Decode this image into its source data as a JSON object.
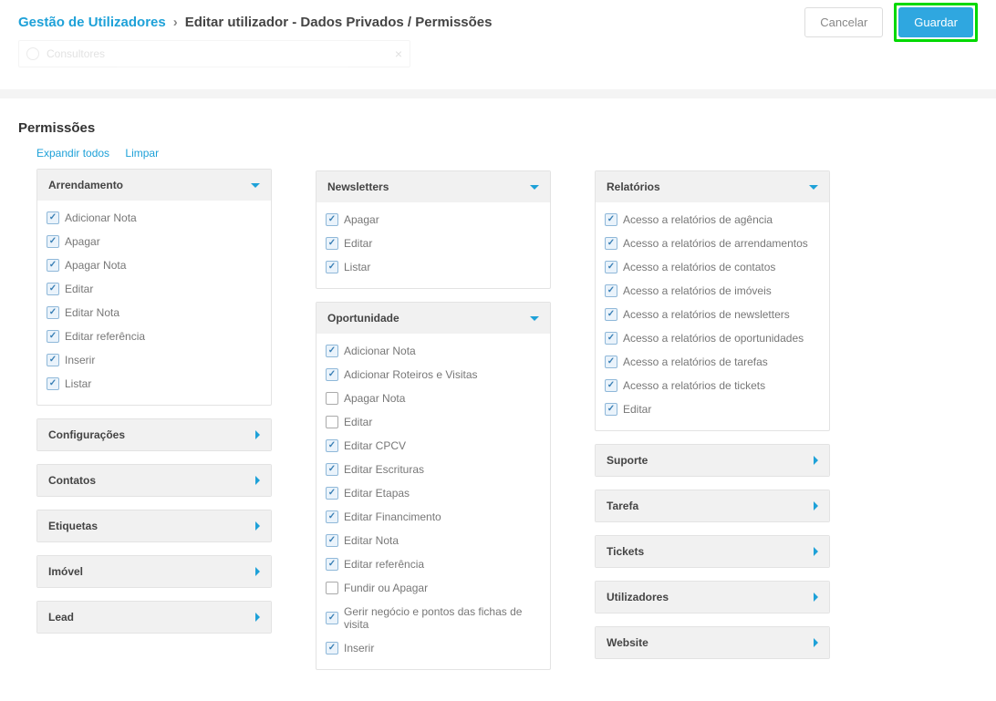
{
  "header": {
    "breadcrumb_link": "Gestão de Utilizadores",
    "separator": "›",
    "current": "Editar utilizador -  Dados Privados / Permissões",
    "cancel_label": "Cancelar",
    "save_label": "Guardar"
  },
  "tag_row": {
    "text": "Consultores",
    "close": "×"
  },
  "section_title": "Permissões",
  "links": {
    "expand_all": "Expandir todos",
    "clear": "Limpar"
  },
  "columns": [
    {
      "panels": [
        {
          "id": "arrendamento",
          "title": "Arrendamento",
          "expanded": true,
          "items": [
            {
              "label": "Adicionar Nota",
              "checked": true
            },
            {
              "label": "Apagar",
              "checked": true
            },
            {
              "label": "Apagar Nota",
              "checked": true
            },
            {
              "label": "Editar",
              "checked": true
            },
            {
              "label": "Editar Nota",
              "checked": true
            },
            {
              "label": "Editar referência",
              "checked": true
            },
            {
              "label": "Inserir",
              "checked": true
            },
            {
              "label": "Listar",
              "checked": true
            }
          ]
        },
        {
          "id": "configuracoes",
          "title": "Configurações",
          "expanded": false
        },
        {
          "id": "contatos",
          "title": "Contatos",
          "expanded": false
        },
        {
          "id": "etiquetas",
          "title": "Etiquetas",
          "expanded": false
        },
        {
          "id": "imovel",
          "title": "Imóvel",
          "expanded": false
        },
        {
          "id": "lead",
          "title": "Lead",
          "expanded": false
        }
      ]
    },
    {
      "panels": [
        {
          "id": "newsletters",
          "title": "Newsletters",
          "expanded": true,
          "items": [
            {
              "label": "Apagar",
              "checked": true
            },
            {
              "label": "Editar",
              "checked": true
            },
            {
              "label": "Listar",
              "checked": true
            }
          ]
        },
        {
          "id": "oportunidade",
          "title": "Oportunidade",
          "expanded": true,
          "items": [
            {
              "label": "Adicionar Nota",
              "checked": true
            },
            {
              "label": "Adicionar Roteiros e Visitas",
              "checked": true
            },
            {
              "label": "Apagar Nota",
              "checked": false
            },
            {
              "label": "Editar",
              "checked": false
            },
            {
              "label": "Editar CPCV",
              "checked": true
            },
            {
              "label": "Editar Escrituras",
              "checked": true
            },
            {
              "label": "Editar Etapas",
              "checked": true
            },
            {
              "label": "Editar Financimento",
              "checked": true
            },
            {
              "label": "Editar Nota",
              "checked": true
            },
            {
              "label": "Editar referência",
              "checked": true
            },
            {
              "label": "Fundir ou Apagar",
              "checked": false
            },
            {
              "label": "Gerir negócio e pontos das fichas de visita",
              "checked": true
            },
            {
              "label": "Inserir",
              "checked": true
            }
          ]
        }
      ]
    },
    {
      "panels": [
        {
          "id": "relatorios",
          "title": "Relatórios",
          "expanded": true,
          "items": [
            {
              "label": "Acesso a relatórios de agência",
              "checked": true
            },
            {
              "label": "Acesso a relatórios de arrendamentos",
              "checked": true
            },
            {
              "label": "Acesso a relatórios de contatos",
              "checked": true
            },
            {
              "label": "Acesso a relatórios de imóveis",
              "checked": true
            },
            {
              "label": "Acesso a relatórios de newsletters",
              "checked": true
            },
            {
              "label": "Acesso a relatórios de oportunidades",
              "checked": true
            },
            {
              "label": "Acesso a relatórios de tarefas",
              "checked": true
            },
            {
              "label": "Acesso a relatórios de tickets",
              "checked": true
            },
            {
              "label": "Editar",
              "checked": true
            }
          ]
        },
        {
          "id": "suporte",
          "title": "Suporte",
          "expanded": false
        },
        {
          "id": "tarefa",
          "title": "Tarefa",
          "expanded": false
        },
        {
          "id": "tickets",
          "title": "Tickets",
          "expanded": false
        },
        {
          "id": "utilizadores",
          "title": "Utilizadores",
          "expanded": false
        },
        {
          "id": "website",
          "title": "Website",
          "expanded": false
        }
      ]
    }
  ]
}
